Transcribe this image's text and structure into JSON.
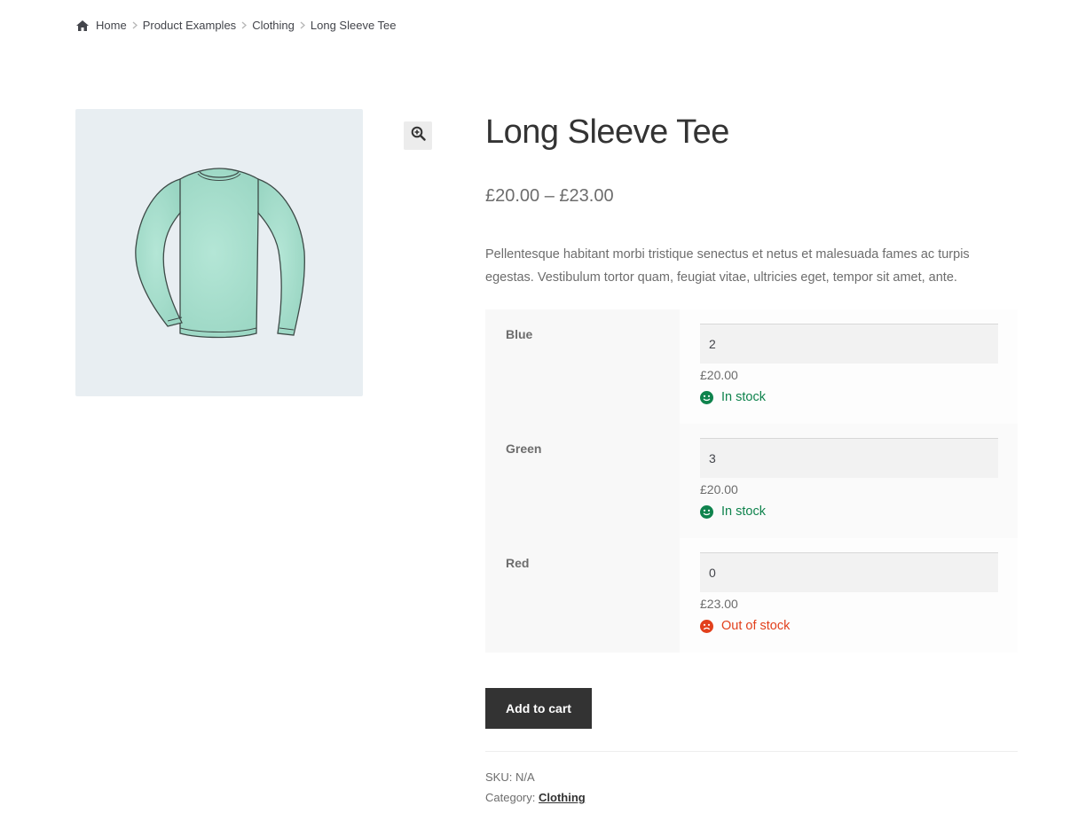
{
  "breadcrumb": {
    "icon": "home-icon",
    "items": [
      "Home",
      "Product Examples",
      "Clothing"
    ],
    "current": "Long Sleeve Tee"
  },
  "gallery": {
    "image": "long-sleeve-tee-illustration",
    "zoom_icon": "zoom-in-icon"
  },
  "product": {
    "title": "Long Sleeve Tee",
    "price": "£20.00 – £23.00",
    "description": "Pellentesque habitant morbi tristique senectus et netus et malesuada fames ac turpis egestas. Vestibulum tortor quam, feugiat vitae, ultricies eget, tempor sit amet, ante."
  },
  "variations": [
    {
      "label": "Blue",
      "quantity": "2",
      "price": "£20.00",
      "stock": "In stock",
      "in_stock": true
    },
    {
      "label": "Green",
      "quantity": "3",
      "price": "£20.00",
      "stock": "In stock",
      "in_stock": true
    },
    {
      "label": "Red",
      "quantity": "0",
      "price": "£23.00",
      "stock": "Out of stock",
      "in_stock": false
    }
  ],
  "actions": {
    "add_to_cart": "Add to cart"
  },
  "meta": {
    "sku_label": "SKU:",
    "sku_value": "N/A",
    "category_label": "Category:",
    "category_value": "Clothing"
  },
  "colors": {
    "in_stock": "#0f834d",
    "out_of_stock": "#e2401c",
    "button": "#333333"
  }
}
